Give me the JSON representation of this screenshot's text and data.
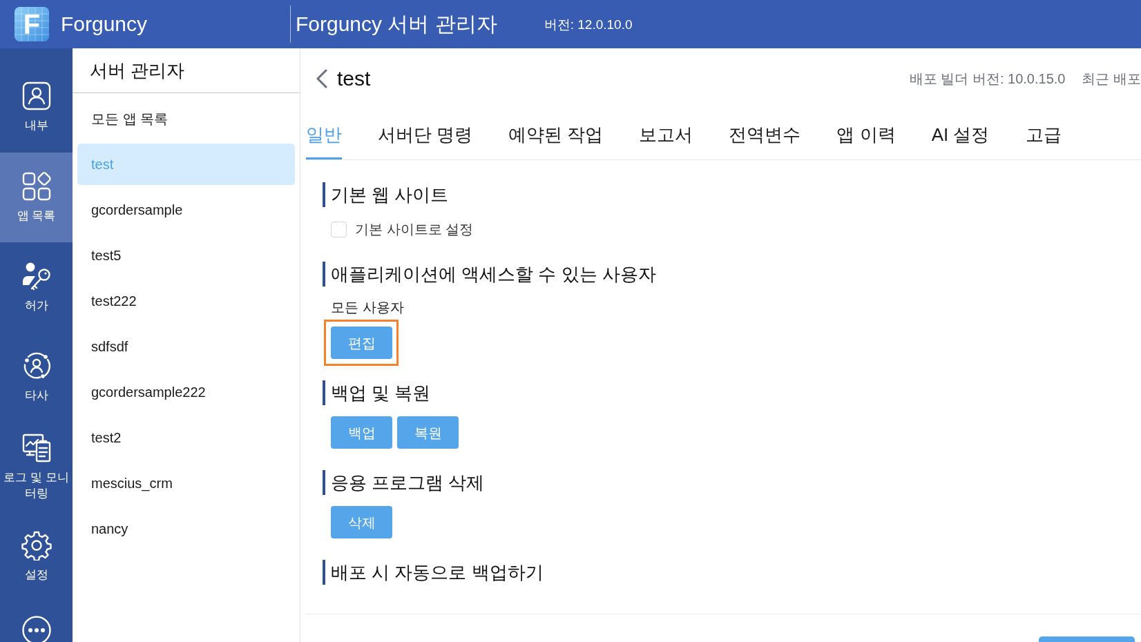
{
  "header": {
    "logo_letter": "F",
    "brand": "Forguncy",
    "title": "Forguncy 서버 관리자",
    "version": "버전: 12.0.10.0"
  },
  "nav": [
    {
      "kind": "internal",
      "label": "내부",
      "selected": false
    },
    {
      "kind": "apps",
      "label": "앱 목록",
      "selected": true
    },
    {
      "kind": "permission",
      "label": "허가",
      "selected": false
    },
    {
      "kind": "third_party",
      "label": "타사",
      "selected": false
    },
    {
      "kind": "logs",
      "label": "로그 및 모니터링",
      "selected": false
    },
    {
      "kind": "settings",
      "label": "설정",
      "selected": false
    },
    {
      "kind": "more",
      "selected": false
    }
  ],
  "app_list": {
    "title": "서버 관리자",
    "all_apps": "모든 앱 목록",
    "apps": [
      {
        "name": "test",
        "selected": true
      },
      {
        "name": "gcordersample",
        "selected": false
      },
      {
        "name": "test5",
        "selected": false
      },
      {
        "name": "test222",
        "selected": false
      },
      {
        "name": "sdfsdf",
        "selected": false
      },
      {
        "name": "gcordersample222",
        "selected": false
      },
      {
        "name": "test2",
        "selected": false
      },
      {
        "name": "mescius_crm",
        "selected": false
      },
      {
        "name": "nancy",
        "selected": false
      }
    ]
  },
  "main": {
    "title": "test",
    "builder_version": "배포 빌더 버전: 10.0.15.0",
    "last_deploy": "최근 배포",
    "tabs": [
      {
        "label": "일반",
        "selected": true
      },
      {
        "label": "서버단 명령",
        "selected": false
      },
      {
        "label": "예약된 작업",
        "selected": false
      },
      {
        "label": "보고서",
        "selected": false
      },
      {
        "label": "전역변수",
        "selected": false
      },
      {
        "label": "앱 이력",
        "selected": false
      },
      {
        "label": "AI 설정",
        "selected": false
      },
      {
        "label": "고급",
        "selected": false
      }
    ],
    "sections": [
      {
        "title": "기본 웹 사이트",
        "items": [
          {
            "kind": "checkbox",
            "label": "기본 사이트로 설정",
            "checked": false
          }
        ]
      },
      {
        "title": "애플리케이션에 액세스할 수 있는 사용자",
        "items": [
          {
            "kind": "text",
            "text": "모든 사용자"
          },
          {
            "kind": "buttons",
            "buttons": [
              {
                "label": "편집",
                "highlighted": true
              }
            ]
          }
        ]
      },
      {
        "title": "백업 및 복원",
        "items": [
          {
            "kind": "buttons",
            "buttons": [
              {
                "label": "백업",
                "highlighted": false
              },
              {
                "label": "복원",
                "highlighted": false
              }
            ]
          }
        ]
      },
      {
        "title": "응용 프로그램 삭제",
        "items": [
          {
            "kind": "buttons",
            "buttons": [
              {
                "label": "삭제",
                "highlighted": false
              }
            ]
          }
        ]
      },
      {
        "title": "배포 시 자동으로 백업하기"
      }
    ]
  }
}
